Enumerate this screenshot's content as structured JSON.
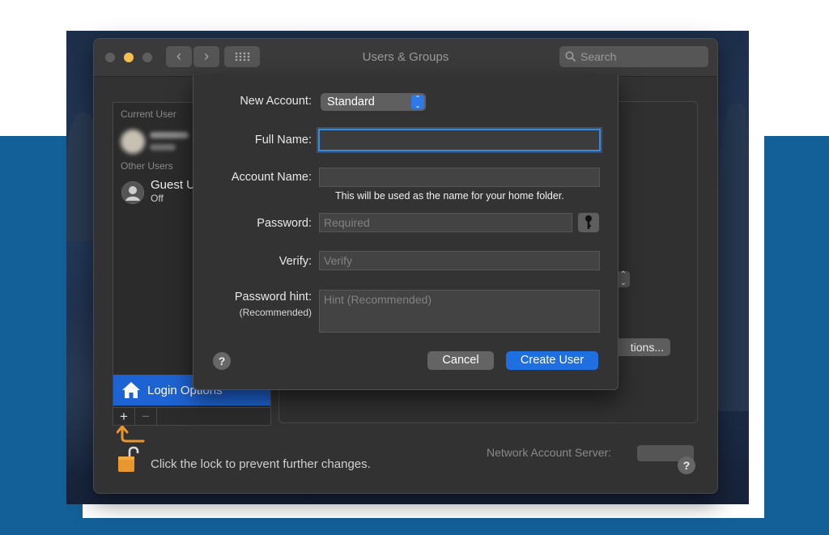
{
  "window": {
    "title": "Users & Groups",
    "search_placeholder": "Search",
    "nav_back": "‹",
    "nav_forward": "›"
  },
  "sidebar": {
    "current_user_header": "Current User",
    "other_users_header": "Other Users",
    "guest_name": "Guest U",
    "guest_status": "Off",
    "login_options_label": "Login Options",
    "add_label": "+",
    "remove_label": "−"
  },
  "background_panel": {
    "options_button_label": "tions...",
    "network_server_label": "Network Account Server:"
  },
  "footer": {
    "lock_text": "Click the lock to prevent further changes.",
    "help_label": "?"
  },
  "dialog": {
    "new_account_label": "New Account:",
    "new_account_value": "Standard",
    "full_name_label": "Full Name:",
    "full_name_value": "",
    "account_name_label": "Account Name:",
    "account_name_value": "",
    "account_name_note": "This will be used as the name for your home folder.",
    "password_label": "Password:",
    "password_placeholder": "Required",
    "verify_label": "Verify:",
    "verify_placeholder": "Verify",
    "hint_label": "Password hint:",
    "hint_sublabel": "(Recommended)",
    "hint_placeholder": "Hint (Recommended)",
    "help_label": "?",
    "cancel_label": "Cancel",
    "create_label": "Create User"
  },
  "colors": {
    "accent": "#1f6fe0",
    "background_band": "#135f97",
    "lock_orange": "#e8962e"
  }
}
